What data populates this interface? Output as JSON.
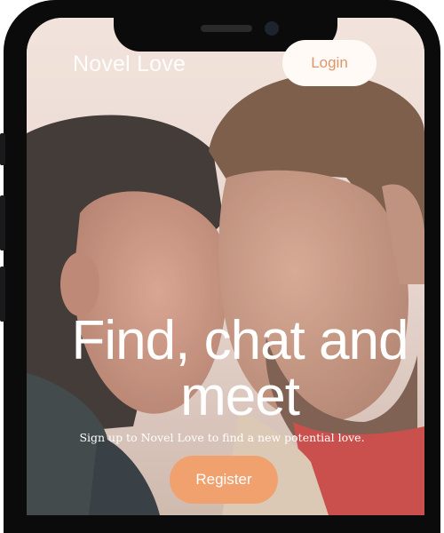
{
  "app": {
    "logo_text": "Novel Love"
  },
  "header": {
    "login_label": "Login"
  },
  "hero": {
    "headline": "Find, chat and meet",
    "subtitle": "Sign up to Novel Love to find a new potential love.",
    "register_label": "Register",
    "image": "couple-photo"
  },
  "colors": {
    "accent": "#f0a16e",
    "login_text": "#e1956a",
    "device": "#0b0b0c"
  }
}
